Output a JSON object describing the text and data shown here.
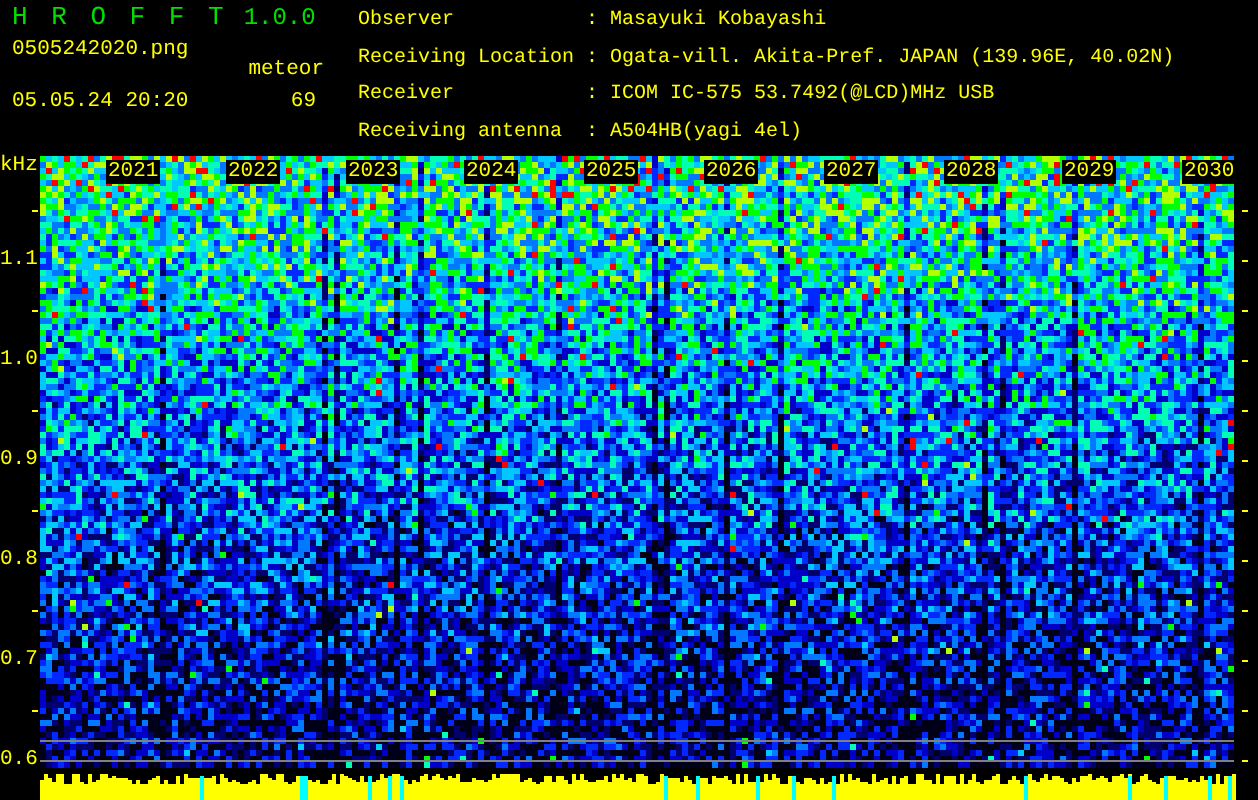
{
  "app": {
    "name": "H R O F F T",
    "version": "1.0.0"
  },
  "file": "0505242020.png",
  "datetime": "05.05.24 20:20",
  "counter": {
    "label": "meteor",
    "value": "69"
  },
  "info": [
    {
      "label": "Observer",
      "separator": ":",
      "value": "Masayuki Kobayashi"
    },
    {
      "label": "Receiving Location",
      "separator": ":",
      "value": "Ogata-vill. Akita-Pref. JAPAN (139.96E, 40.02N)"
    },
    {
      "label": "Receiver",
      "separator": ":",
      "value": "ICOM IC-575 53.7492(@LCD)MHz USB"
    },
    {
      "label": "Receiving antenna",
      "separator": ":",
      "value": "A504HB(yagi 4el)"
    }
  ],
  "spectrogram": {
    "unit": "kHz",
    "freq_labels": [
      "1.1",
      "1.0",
      "0.9",
      "0.8",
      "0.7",
      "0.6"
    ],
    "time_labels": [
      "2021",
      "2022",
      "2023",
      "2024",
      "2025",
      "2026",
      "2027",
      "2028",
      "2029",
      "2030"
    ]
  }
}
